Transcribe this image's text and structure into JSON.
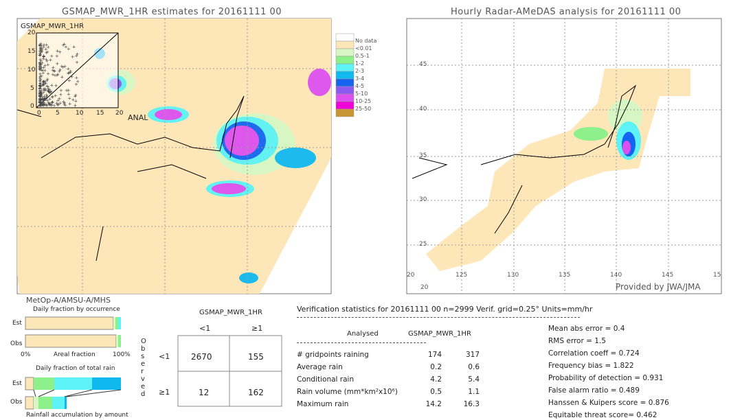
{
  "left_map": {
    "title": "GSMAP_MWR_1HR estimates for 20161111 00",
    "inset_ylabel": "GSMAP_MWR_1HR",
    "inset_xlabel": "ANAL",
    "inset_yticks": [
      "20",
      "15",
      "10",
      "5",
      "0"
    ],
    "inset_xticks": [
      "0",
      "5",
      "10",
      "15",
      "20"
    ],
    "satellite": "MetOp-A/AMSU-A/MHS"
  },
  "legend": {
    "items": [
      {
        "label": "No data",
        "color": "#ffffff"
      },
      {
        "label": "<0.01",
        "color": "#fde6b8"
      },
      {
        "label": "0.5-1",
        "color": "#d6f7c4"
      },
      {
        "label": "1-2",
        "color": "#8ef08a"
      },
      {
        "label": "2-3",
        "color": "#5cf2f6"
      },
      {
        "label": "3-4",
        "color": "#10b8f0"
      },
      {
        "label": "4-5",
        "color": "#1464f0"
      },
      {
        "label": "5-10",
        "color": "#8c5af0"
      },
      {
        "label": "10-25",
        "color": "#dc50f0"
      },
      {
        "label": "25-50",
        "color": "#f000d8"
      },
      {
        "label": "",
        "color": "#c89632"
      }
    ]
  },
  "right_map": {
    "title": "Hourly Radar-AMeDAS analysis for 20161111 00",
    "lat_ticks": [
      "45",
      "40",
      "35",
      "30",
      "25",
      "20"
    ],
    "lon_ticks": [
      "20",
      "125",
      "130",
      "135",
      "140",
      "145",
      "15"
    ],
    "credit": "Provided by JWA/JMA"
  },
  "fraction_charts": {
    "occurrence_title": "Daily fraction by occurrence",
    "est_label": "Est",
    "obs_label": "Obs",
    "axis_left": "0%",
    "axis_mid": "Areal fraction",
    "axis_right": "100%",
    "total_rain_title": "Daily fraction of total rain",
    "accumulation_title": "Rainfall accumulation by amount"
  },
  "contingency": {
    "header": "GSMAP_MWR_1HR",
    "col_labels": [
      "<1",
      "≥1"
    ],
    "row_labels": [
      "<1",
      "≥1"
    ],
    "observed_letters": [
      "O",
      "b",
      "s",
      "e",
      "r",
      "v",
      "e",
      "d"
    ],
    "cells": [
      [
        "2670",
        "155"
      ],
      [
        "12",
        "162"
      ]
    ]
  },
  "stats": {
    "title": "Verification statistics for 20161111 00   n=2999   Verif. grid=0.25°   Units=mm/hr",
    "col_analysed": "Analysed",
    "col_gsmap": "GSMAP_MWR_1HR",
    "rows": [
      {
        "label": "# gridpoints raining",
        "analysed": "174",
        "gsmap": "317"
      },
      {
        "label": "Average rain",
        "analysed": "0.2",
        "gsmap": "0.6"
      },
      {
        "label": "Conditional rain",
        "analysed": "4.2",
        "gsmap": "5.4"
      },
      {
        "label": "Rain volume (mm*km²x10⁶)",
        "analysed": "0.5",
        "gsmap": "1.1"
      },
      {
        "label": "Maximum rain",
        "analysed": "14.2",
        "gsmap": "16.3"
      }
    ],
    "scores": [
      "Mean abs error = 0.4",
      "RMS error = 1.5",
      "Correlation coeff = 0.724",
      "Frequency bias = 1.822",
      "Probability of detection = 0.931",
      "False alarm ratio = 0.489",
      "Hanssen & Kuipers score = 0.876",
      "Equitable threat score= 0.462"
    ]
  }
}
